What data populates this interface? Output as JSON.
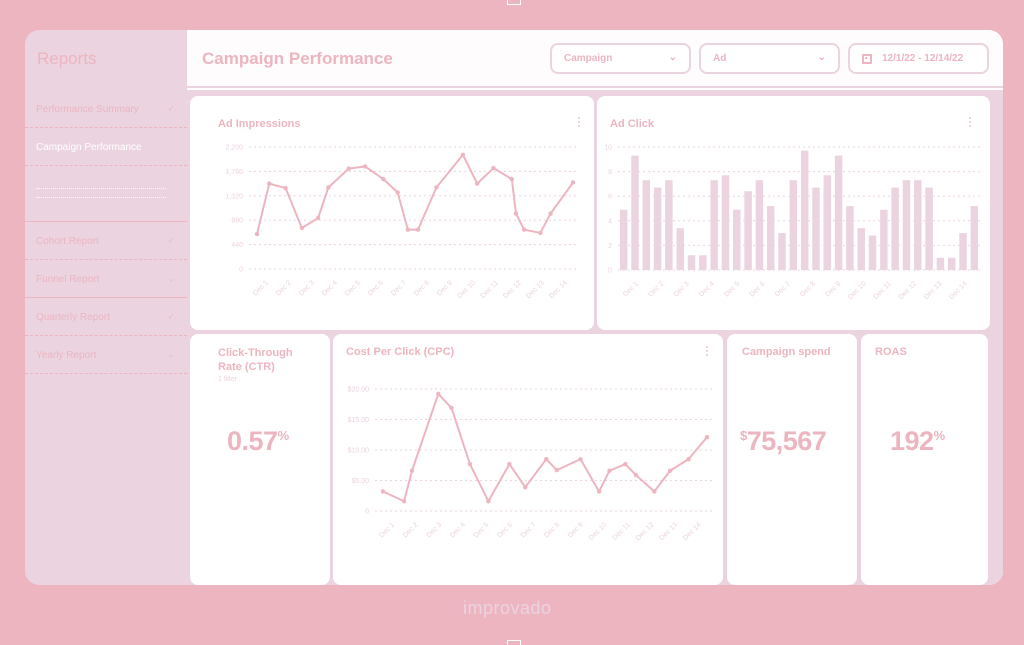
{
  "sidebar": {
    "title": "Reports",
    "items": [
      {
        "label": "Performance Summary",
        "chevron": "✓",
        "active": false
      },
      {
        "label": "Campaign Performance",
        "chevron": "",
        "active": true
      },
      {
        "label": "",
        "chevron": "",
        "active": false
      },
      {
        "label": "Cohort Report",
        "chevron": "✓",
        "active": false
      },
      {
        "label": "Funnel Report",
        "chevron": "⌄",
        "active": false
      },
      {
        "label": "Quarterly Report",
        "chevron": "✓",
        "active": false
      },
      {
        "label": "Yearly Report",
        "chevron": "⌄",
        "active": false
      }
    ]
  },
  "header": {
    "title": "Campaign Performance",
    "filters": {
      "campaign": "Campaign",
      "ad": "Ad",
      "date_range": "12/1/22 - 12/14/22"
    },
    "chevron_icon": "⌄"
  },
  "cards": {
    "impressions": {
      "title": "Ad Impressions"
    },
    "clicks": {
      "title": "Ad Click"
    },
    "ctr": {
      "title_line1": "Click-Through",
      "title_line2": "Rate (CTR)",
      "subtitle": "1 filter",
      "value": "0.57",
      "unit": "%"
    },
    "cpc": {
      "title": "Cost Per Click (CPC)"
    },
    "spend": {
      "title": "Campaign spend",
      "currency": "$",
      "value": "75,567"
    },
    "roas": {
      "title": "ROAS",
      "value": "192",
      "unit": "%"
    }
  },
  "footer": {
    "brand": "improvado"
  },
  "chart_data": [
    {
      "id": "impressions",
      "type": "line",
      "title": "Ad Impressions",
      "categories": [
        "Dec 1",
        "Dec 2",
        "Dec 3",
        "Dec 4",
        "Dec 5",
        "Dec 6",
        "Dec 7",
        "Dec 8",
        "Dec 9",
        "Dec 10",
        "Dec 11",
        "Dec 12",
        "Dec 13",
        "Dec 14"
      ],
      "x": [
        0,
        0.6,
        1.4,
        2.2,
        3.0,
        3.5,
        4.5,
        5.3,
        6.2,
        6.9,
        7.4,
        7.9,
        8.8,
        10.1,
        10.8,
        11.6,
        12.5,
        12.7,
        13.1,
        13.9,
        14.4,
        15.5
      ],
      "values": [
        630,
        1540,
        1460,
        740,
        920,
        1470,
        1810,
        1850,
        1620,
        1380,
        710,
        710,
        1470,
        2060,
        1540,
        1820,
        1620,
        1000,
        710,
        650,
        1000,
        1560
      ],
      "yticks": [
        "0",
        "440",
        "880",
        "1,320",
        "1,760",
        "2,200"
      ],
      "ylim": [
        0,
        2200
      ],
      "xlim": [
        0,
        15.5
      ],
      "grid": true,
      "color": "#ecb5c0"
    },
    {
      "id": "clicks",
      "type": "bar",
      "title": "Ad Click",
      "categories": [
        "Dec 1",
        "Dec 2",
        "Dec 3",
        "Dec 4",
        "Dec 5",
        "Dec 6",
        "Dec 7",
        "Dec 8",
        "Dec 9",
        "Dec 10",
        "Dec 11",
        "Dec 12",
        "Dec 13",
        "Dec 14"
      ],
      "values": [
        4.9,
        9.3,
        7.3,
        6.7,
        7.3,
        3.4,
        1.2,
        1.2,
        7.3,
        7.7,
        4.9,
        6.4,
        7.3,
        5.2,
        3.0,
        7.3,
        9.7,
        6.7,
        7.7,
        9.3,
        5.2,
        3.4,
        2.8,
        4.9,
        6.7,
        7.3,
        7.3,
        6.7,
        1.0,
        1.0,
        3.0,
        5.2
      ],
      "yticks": [
        "0",
        "2",
        "4",
        "6",
        "8",
        "10"
      ],
      "ylim": [
        0,
        10
      ],
      "grid": true,
      "color": "#ebd3e0"
    },
    {
      "id": "cpc",
      "type": "line",
      "title": "Cost Per Click (CPC)",
      "categories": [
        "Dec 1",
        "Dec 2",
        "Dec 3",
        "Dec 4",
        "Dec 5",
        "Dec 6",
        "Dec 7",
        "Dec 8",
        "Dec 9",
        "Dec 10",
        "Dec 11",
        "Dec 12",
        "Dec 13",
        "Dec 14"
      ],
      "x": [
        0,
        0.8,
        1.1,
        2.1,
        2.6,
        3.3,
        4.0,
        4.8,
        5.4,
        6.2,
        6.6,
        7.5,
        8.2,
        8.6,
        9.2,
        9.6,
        10.3,
        10.9,
        11.6,
        12.3
      ],
      "values": [
        3.2,
        1.6,
        6.6,
        19.2,
        16.9,
        7.7,
        1.6,
        7.7,
        3.9,
        8.5,
        6.7,
        8.5,
        3.2,
        6.6,
        7.7,
        5.9,
        3.2,
        6.6,
        8.5,
        12.1
      ],
      "yticks": [
        "0",
        "$5.00",
        "$10.00",
        "$15.00",
        "$20.00"
      ],
      "ylim": [
        0,
        20
      ],
      "xlim": [
        0,
        12.3
      ],
      "grid": true,
      "color": "#ecb5c0"
    }
  ]
}
